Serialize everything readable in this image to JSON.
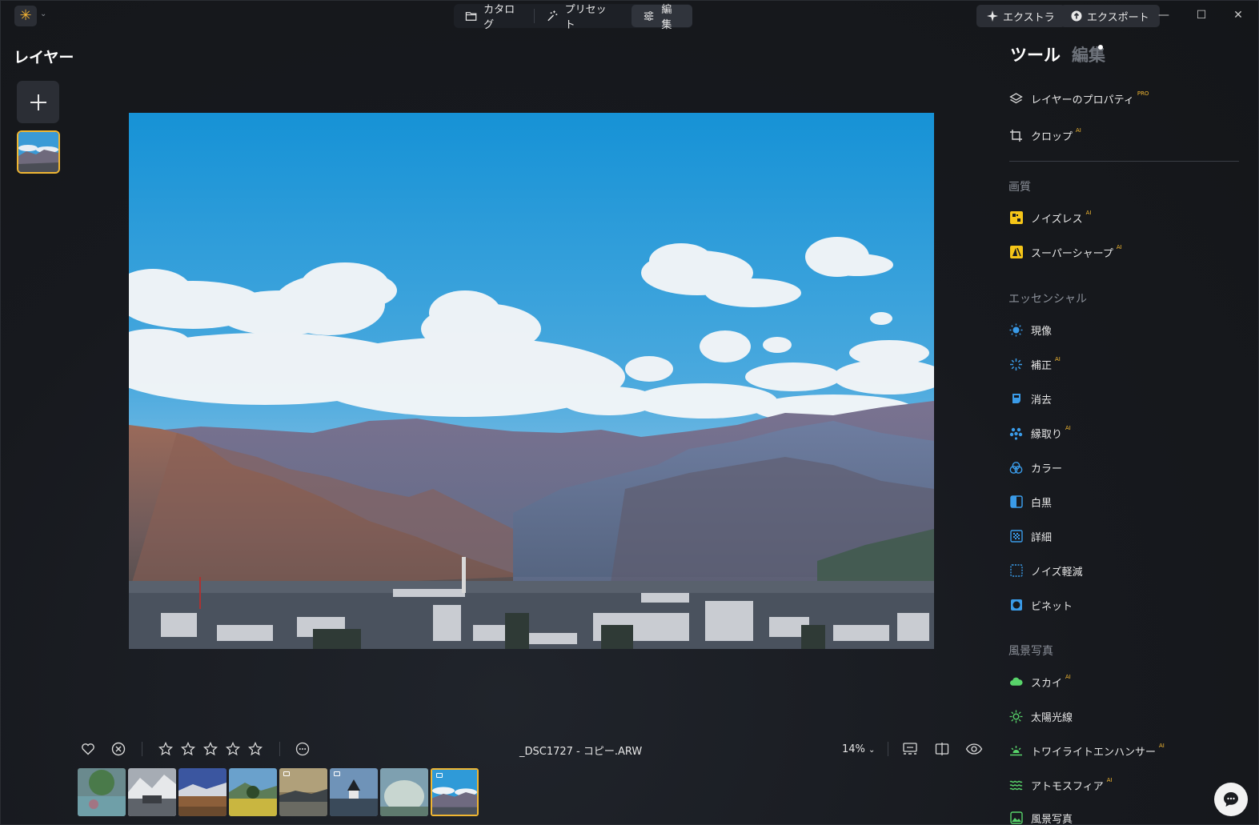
{
  "titlebar": {
    "modes": [
      {
        "label": "カタログ",
        "icon": "folder-icon"
      },
      {
        "label": "プリセット",
        "icon": "magic-wand-icon"
      },
      {
        "label": "編集",
        "icon": "sliders-icon",
        "active": true
      }
    ],
    "extras_label": "エクストラ",
    "export_label": "エクスポート",
    "minimize": "—",
    "maximize": "☐",
    "close": "✕",
    "logo_glyph": "✳"
  },
  "layers": {
    "title": "レイヤー",
    "add_glyph": "+"
  },
  "bottom_bar": {
    "filename": "_DSC1727 - コピー.ARW",
    "zoom": "14%",
    "zoom_chevron": "⌄",
    "rating_max": 5
  },
  "filmstrip": {
    "count": 8,
    "active_index": 7
  },
  "tools_panel": {
    "tab_tools": "ツール",
    "tab_edit": "編集",
    "items_top": [
      {
        "label": "レイヤーのプロパティ",
        "tag": "PRO",
        "icon": "layers-icon"
      },
      {
        "label": "クロップ",
        "tag": "AI",
        "icon": "crop-icon"
      }
    ],
    "section_quality": "画質",
    "items_quality": [
      {
        "label": "ノイズレス",
        "tag": "AI",
        "icon": "noiseless-icon"
      },
      {
        "label": "スーパーシャープ",
        "tag": "AI",
        "icon": "supersharp-icon"
      }
    ],
    "section_essentials": "エッセンシャル",
    "items_essentials": [
      {
        "label": "現像",
        "tag": "",
        "icon": "sun-icon"
      },
      {
        "label": "補正",
        "tag": "AI",
        "icon": "sparkle-icon"
      },
      {
        "label": "消去",
        "tag": "",
        "icon": "eraser-icon"
      },
      {
        "label": "縁取り",
        "tag": "AI",
        "icon": "dots-icon"
      },
      {
        "label": "カラー",
        "tag": "",
        "icon": "color-circles-icon"
      },
      {
        "label": "白黒",
        "tag": "",
        "icon": "bw-icon"
      },
      {
        "label": "詳細",
        "tag": "",
        "icon": "detail-icon"
      },
      {
        "label": "ノイズ軽減",
        "tag": "",
        "icon": "denoise-icon"
      },
      {
        "label": "ビネット",
        "tag": "",
        "icon": "vignette-icon"
      }
    ],
    "section_landscape": "風景写真",
    "items_landscape": [
      {
        "label": "スカイ",
        "tag": "AI",
        "icon": "cloud-icon"
      },
      {
        "label": "太陽光線",
        "tag": "",
        "icon": "sunrays-icon"
      },
      {
        "label": "トワイライトエンハンサー",
        "tag": "AI",
        "icon": "twilight-icon"
      },
      {
        "label": "アトモスフィア",
        "tag": "AI",
        "icon": "waves-icon"
      },
      {
        "label": "風景写真",
        "tag": "",
        "icon": "landscape-icon"
      }
    ]
  },
  "colors": {
    "accent": "#f0b632",
    "background": "#16181d",
    "panel_button": "#2b2e35",
    "sky_top": "#1a95d6",
    "icon_blue": "#3a9be8",
    "icon_green": "#58d36a",
    "icon_yellow": "#f5c518"
  }
}
